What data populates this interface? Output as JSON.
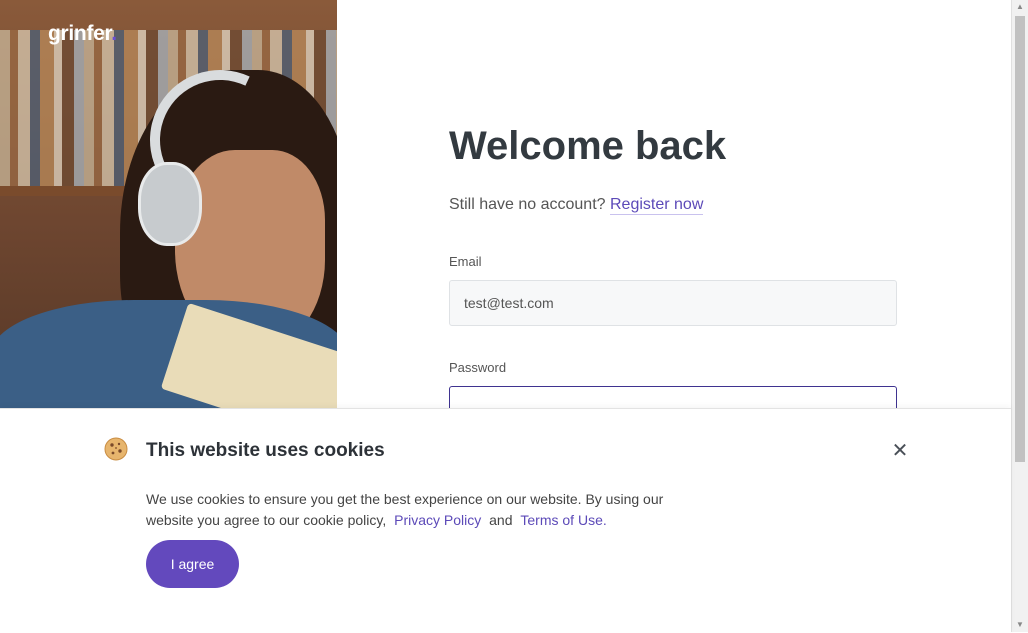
{
  "brand": {
    "name": "grinfer",
    "dot": ".",
    "accent": "#6a4fd4"
  },
  "login": {
    "title": "Welcome back",
    "no_account_text": "Still have no account?",
    "register_link": "Register now",
    "email_label": "Email",
    "email_value": "test@test.com",
    "password_label": "Password",
    "password_value": ""
  },
  "cookie_banner": {
    "icon": "cookie-icon",
    "title": "This website uses cookies",
    "text": "We use cookies to ensure you get the best experience on our website. By using our website you agree to our cookie policy,",
    "privacy_link": "Privacy Policy",
    "and_text": "and",
    "terms_link": "Terms of Use.",
    "agree_label": "I agree",
    "close_icon": "close-icon"
  },
  "colors": {
    "accent": "#6349bd",
    "link": "#5c4ab8",
    "title": "#333a40"
  }
}
